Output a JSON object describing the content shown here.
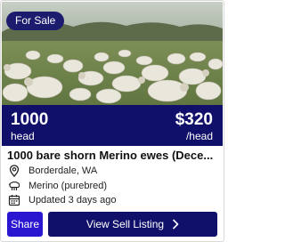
{
  "listing": {
    "badge": "For Sale",
    "photo_icon": "sheep-field-photo",
    "quantity": "1000",
    "quantity_unit": "head",
    "price": "$320",
    "price_unit": "/head",
    "title": "1000 bare shorn Merino ewes (Dece...",
    "location": "Borderdale, WA",
    "breed": "Merino (purebred)",
    "updated": "Updated 3 days ago"
  },
  "actions": {
    "share_label": "Share",
    "view_label": "View Sell Listing"
  },
  "icons": {
    "location": "map-pin-icon",
    "breed": "sheep-icon",
    "updated": "calendar-icon",
    "view": "chevron-right-icon"
  },
  "colors": {
    "navy": "#10106a",
    "share_blue": "#2a16d0",
    "badge_bg": "#1c1c6e"
  }
}
